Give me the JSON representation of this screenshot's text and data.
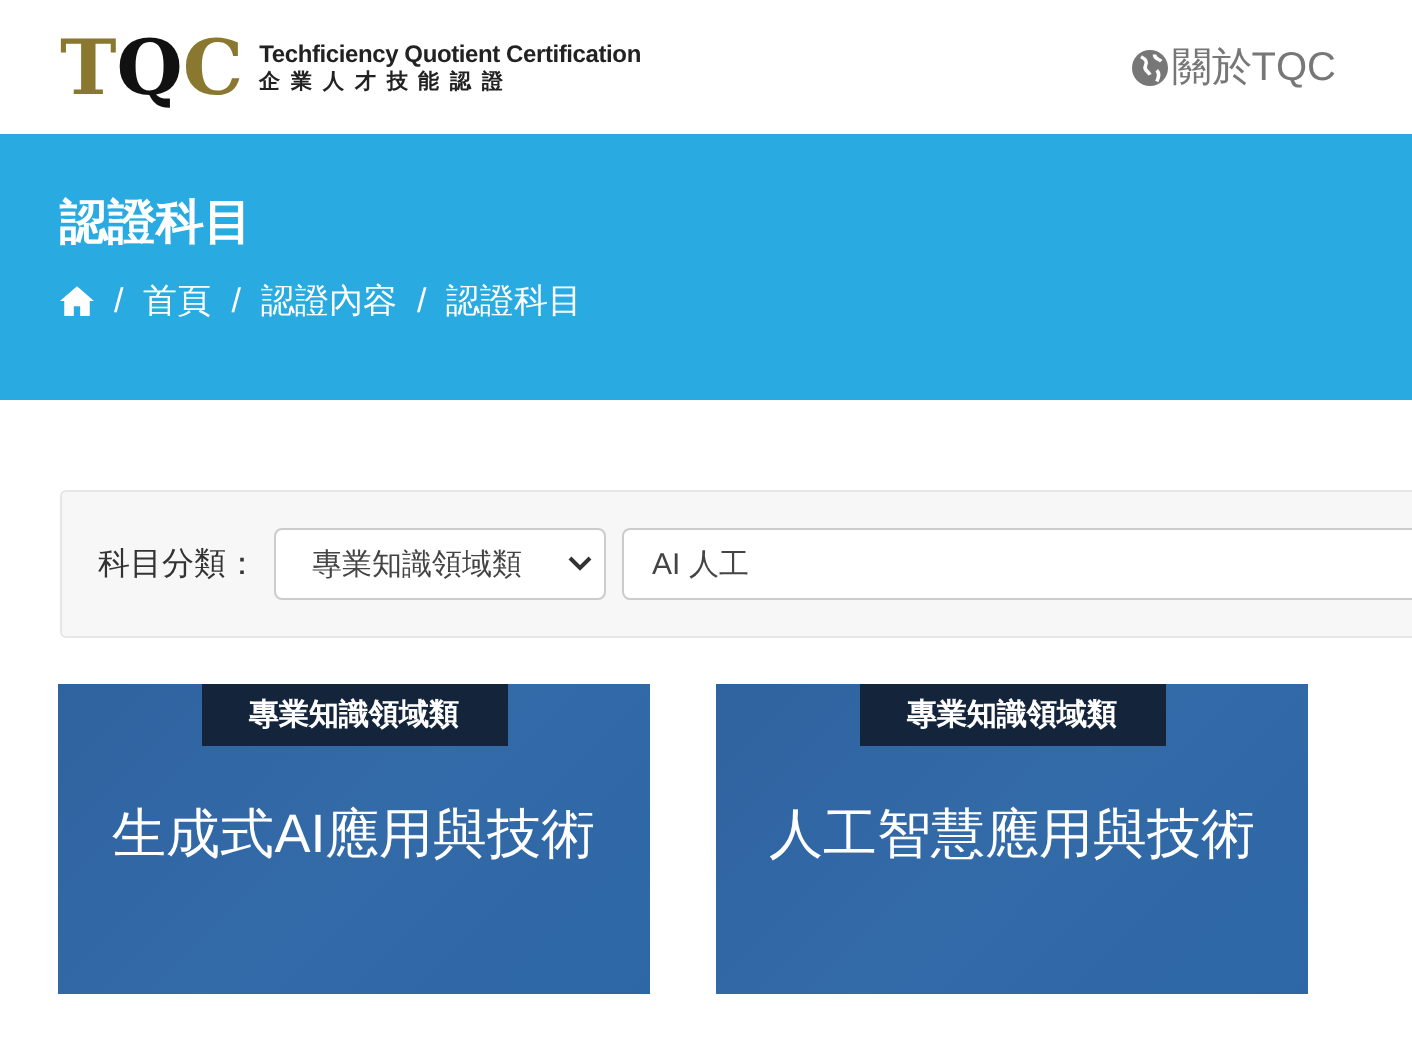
{
  "header": {
    "logo": {
      "letters": [
        "T",
        "Q",
        "C"
      ],
      "tagline": "Techficiency Quotient Certification",
      "subtitle": "企 業 人 才 技 能 認 證"
    },
    "nav": [
      {
        "label": "關於TQC"
      }
    ]
  },
  "banner": {
    "title": "認證科目",
    "breadcrumb": [
      {
        "separator": "/",
        "label": "首頁"
      },
      {
        "separator": "/",
        "label": "認證內容"
      },
      {
        "separator": "/",
        "label": "認證科目"
      }
    ]
  },
  "filter": {
    "label": "科目分類：",
    "category": "專業知識領域類",
    "keyword": "AI 人工"
  },
  "cards": [
    {
      "badge": "專業知識領域類",
      "title": "生成式AI應用與技術"
    },
    {
      "badge": "專業知識領域類",
      "title": "人工智慧應用與技術"
    }
  ]
}
